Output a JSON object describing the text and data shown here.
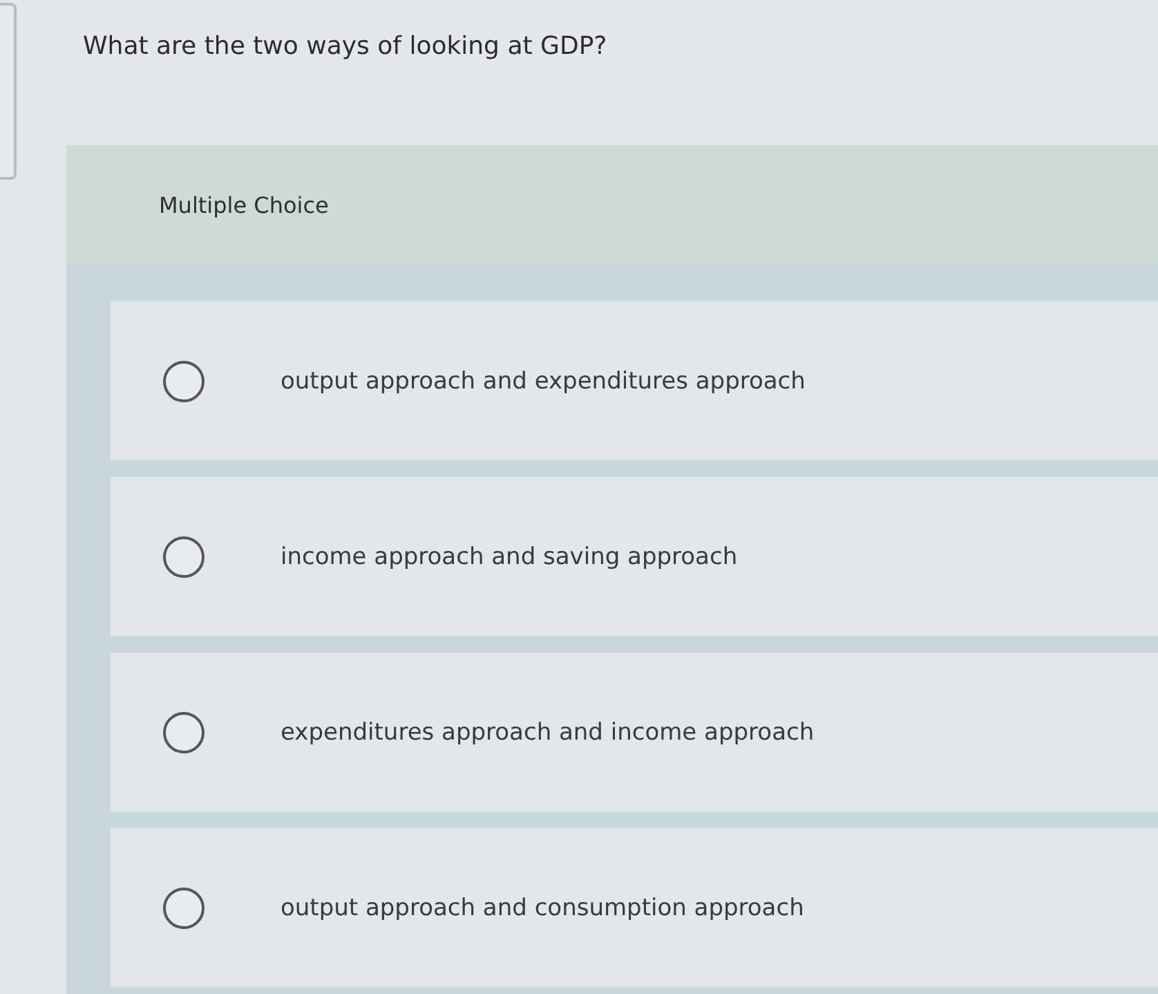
{
  "question": {
    "text": "What are the two ways of looking at GDP?"
  },
  "question_type": {
    "label": "Multiple Choice"
  },
  "options": [
    {
      "label": "output approach and expenditures approach",
      "selected": false
    },
    {
      "label": "income approach and saving approach",
      "selected": false
    },
    {
      "label": "expenditures approach and income approach",
      "selected": false
    },
    {
      "label": "output approach and consumption approach",
      "selected": false
    }
  ]
}
